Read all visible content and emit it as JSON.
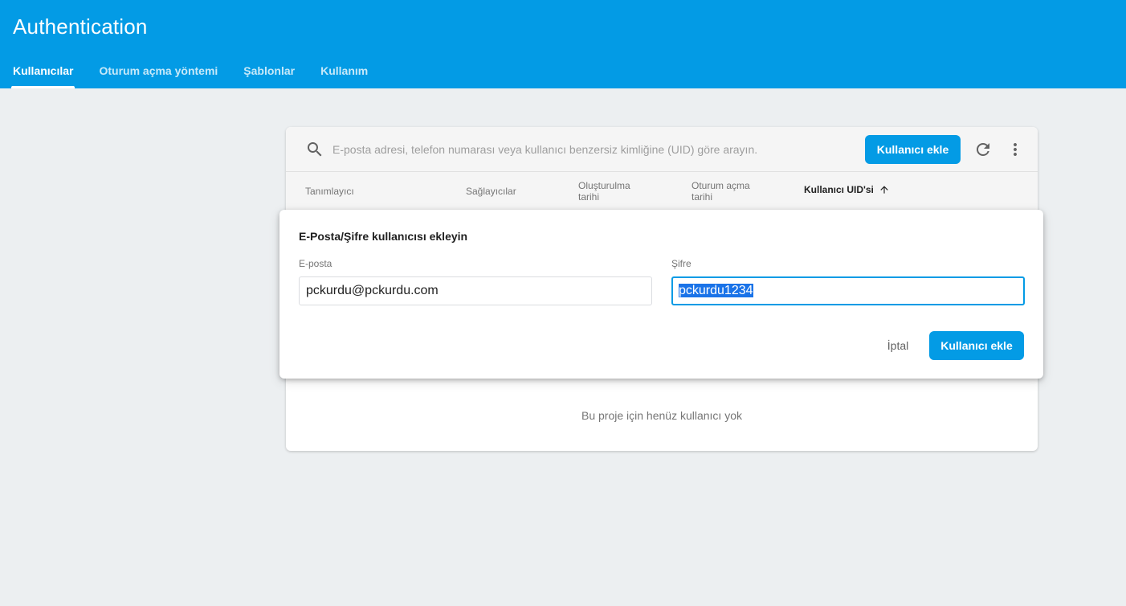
{
  "header": {
    "title": "Authentication",
    "tabs": [
      {
        "label": "Kullanıcılar",
        "active": true
      },
      {
        "label": "Oturum açma yöntemi",
        "active": false
      },
      {
        "label": "Şablonlar",
        "active": false
      },
      {
        "label": "Kullanım",
        "active": false
      }
    ]
  },
  "users_card": {
    "search_placeholder": "E-posta adresi, telefon numarası veya kullanıcı benzersiz kimliğine (UID) göre arayın.",
    "add_user_label": "Kullanıcı ekle",
    "columns": [
      "Tanımlayıcı",
      "Sağlayıcılar",
      "Oluşturulma tarihi",
      "Oturum açma tarihi",
      "Kullanıcı UID'si"
    ],
    "sorted_column": "Kullanıcı UID'si",
    "empty_message": "Bu proje için henüz kullanıcı yok"
  },
  "dialog": {
    "title": "E-Posta/Şifre kullanıcısı ekleyin",
    "email_label": "E-posta",
    "email_value": "pckurdu@pckurdu.com",
    "password_label": "Şifre",
    "password_value": "pckurdu1234",
    "cancel_label": "İptal",
    "submit_label": "Kullanıcı ekle"
  },
  "colors": {
    "brand": "#039be5",
    "background": "#eceff1"
  },
  "icons": [
    "search-icon",
    "refresh-icon",
    "more-vert-icon",
    "arrow-up-icon"
  ]
}
